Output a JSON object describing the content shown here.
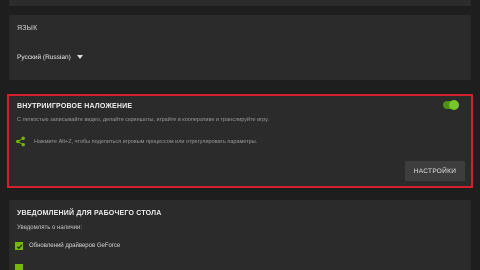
{
  "language": {
    "label": "ЯЗЫК",
    "selected": "Русский (Russian)"
  },
  "overlay": {
    "title": "ВНУТРИИГРОВОЕ НАЛОЖЕНИЕ",
    "enabled": true,
    "description": "С легкостью записывайте видео, делайте скриншоты, играйте в кооперативе и транслируйте игру.",
    "share_hint": "Нажмите Alt+Z, чтобы поделиться игровым процессом или отрегулировать параметры.",
    "settings_button": "НАСТРОЙКИ"
  },
  "notifications": {
    "title": "УВЕДОМЛЕНИЙ ДЛЯ РАБОЧЕГО СТОЛА",
    "subtitle": "Уведомлять о наличии:",
    "items": [
      {
        "label": "Обновлений драйверов GeForce",
        "checked": true
      },
      {
        "label": "",
        "checked": true
      }
    ]
  },
  "colors": {
    "accent": "#76b900",
    "highlight_border": "#d4202a",
    "panel": "#2b2b2b",
    "background": "#1e1e1e"
  },
  "icons": {
    "share": "share-icon",
    "caret": "chevron-down-icon",
    "check": "checkmark-icon"
  }
}
